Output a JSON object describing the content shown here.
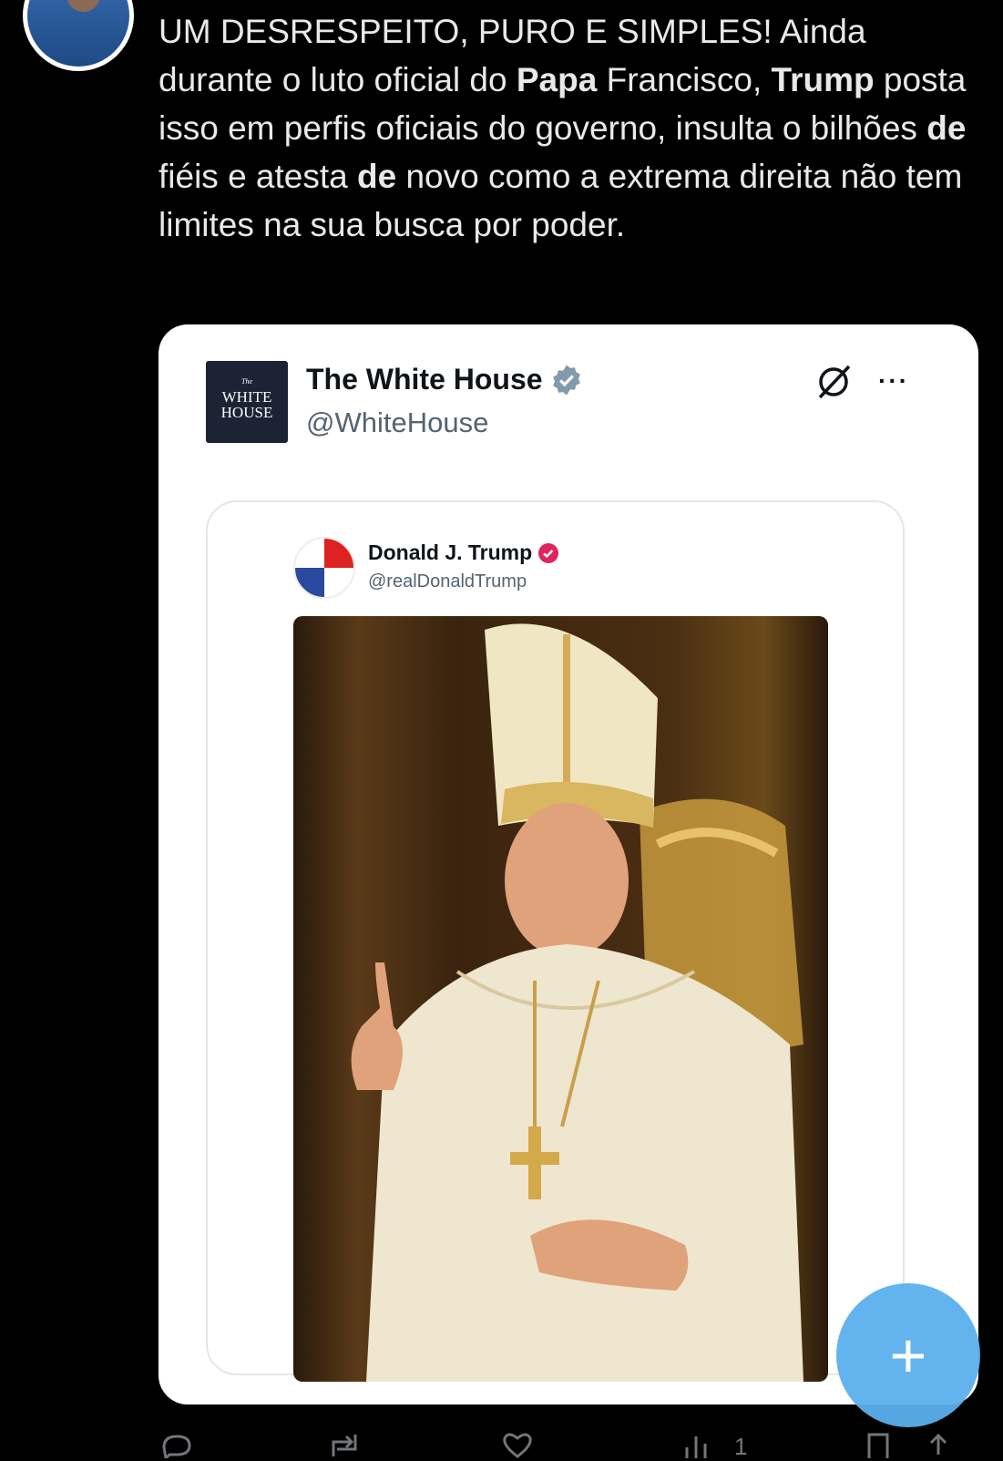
{
  "post": {
    "segments": [
      {
        "text": "UM DESRESPEITO, PURO E SIMPLES! Ainda durante o luto oficial do ",
        "bold": false
      },
      {
        "text": "Papa",
        "bold": true
      },
      {
        "text": " Francisco, ",
        "bold": false
      },
      {
        "text": "Trump",
        "bold": true
      },
      {
        "text": " posta isso em perfis oficiais do governo, insulta o bilhões ",
        "bold": false
      },
      {
        "text": "de",
        "bold": true
      },
      {
        "text": " fiéis e atesta ",
        "bold": false
      },
      {
        "text": "de",
        "bold": true
      },
      {
        "text": " novo como a extrema direita não tem limites na sua busca por poder.",
        "bold": false
      }
    ]
  },
  "embedded": {
    "name": "The White House",
    "handle": "@WhiteHouse",
    "logo_lines": [
      "The",
      "WHITE",
      "HOUSE"
    ],
    "more_label": "···"
  },
  "quoted": {
    "name": "Donald J. Trump",
    "handle": "@realDonaldTrump"
  },
  "actions": {
    "views": "1",
    "fab_label": "+"
  },
  "colors": {
    "background": "#000000",
    "card": "#ffffff",
    "gov_badge": "#829aab",
    "verified_badge": "#e0245e",
    "fab": "#5bb0ee"
  }
}
